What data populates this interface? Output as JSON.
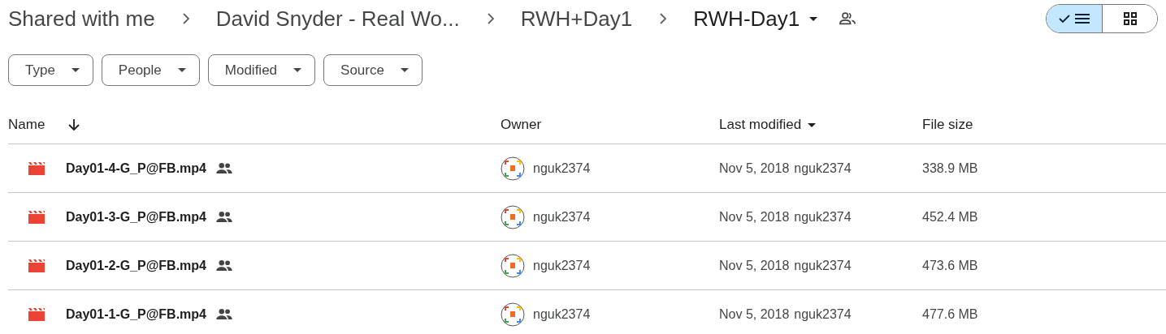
{
  "breadcrumbs": [
    {
      "label": "Shared with me",
      "current": false
    },
    {
      "label": "David Snyder - Real Wo...",
      "current": false
    },
    {
      "label": "RWH+Day1",
      "current": false
    },
    {
      "label": "RWH-Day1",
      "current": true
    }
  ],
  "view_toggle": [
    {
      "kind": "list",
      "selected": true
    },
    {
      "kind": "grid",
      "selected": false
    }
  ],
  "filters": [
    "Type",
    "People",
    "Modified",
    "Source"
  ],
  "table": {
    "columns": [
      {
        "label": "Name",
        "sorted": true
      },
      {
        "label": "Owner"
      },
      {
        "label": "Last modified",
        "has_menu": true
      },
      {
        "label": "File size"
      }
    ],
    "rows": [
      {
        "name": "Day01-4-G_P@FB.mp4",
        "shared": true,
        "owner": "nguk2374",
        "modified": "Nov 5, 2018",
        "modified_by": "nguk2374",
        "size": "338.9 MB"
      },
      {
        "name": "Day01-3-G_P@FB.mp4",
        "shared": true,
        "owner": "nguk2374",
        "modified": "Nov 5, 2018",
        "modified_by": "nguk2374",
        "size": "452.4 MB"
      },
      {
        "name": "Day01-2-G_P@FB.mp4",
        "shared": true,
        "owner": "nguk2374",
        "modified": "Nov 5, 2018",
        "modified_by": "nguk2374",
        "size": "473.6 MB"
      },
      {
        "name": "Day01-1-G_P@FB.mp4",
        "shared": true,
        "owner": "nguk2374",
        "modified": "Nov 5, 2018",
        "modified_by": "nguk2374",
        "size": "477.6 MB"
      }
    ]
  }
}
